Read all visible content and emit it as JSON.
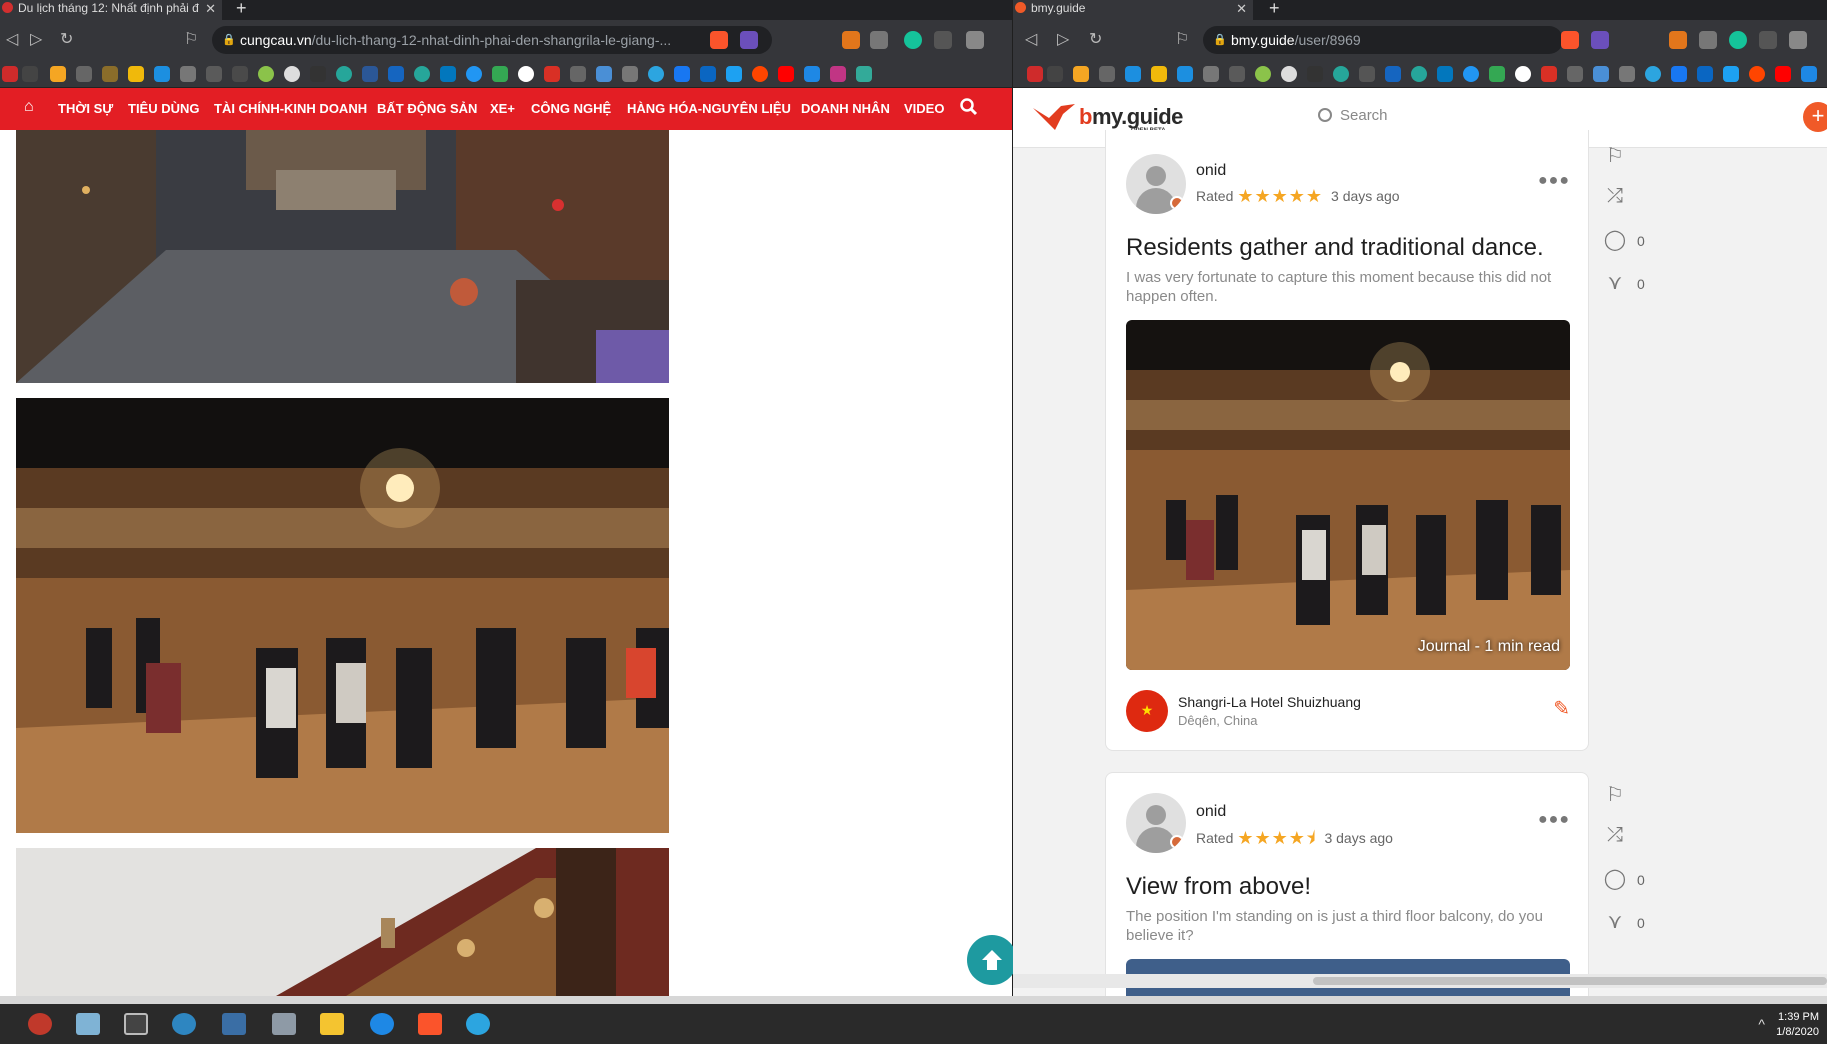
{
  "left_browser": {
    "tab_title": "Du lịch tháng 12: Nhất định phải đ",
    "url_host": "cungcau.vn",
    "url_path": "/du-lich-thang-12-nhat-dinh-phai-den-shangrila-le-giang-...",
    "shield_badge": "12",
    "nav_items": [
      "THỜI SỰ",
      "TIÊU DÙNG",
      "TÀI CHÍNH-KINH DOANH",
      "BẤT ĐỘNG SẢN",
      "XE+",
      "CÔNG NGHỆ",
      "HÀNG HÓA-NGUYÊN LIỆU",
      "DOANH NHÂN",
      "VIDEO"
    ],
    "brand_color": "#e31e24"
  },
  "right_browser": {
    "tab_title": "bmy.guide",
    "url_host": "bmy.guide",
    "url_path": "/user/8969",
    "logo": "bmy.guide",
    "logo_prefix": "b",
    "logo_rest": "my.guide",
    "logo_sub": "OPEN BETA",
    "search_placeholder": "Search",
    "accent_color": "#f05a28"
  },
  "posts": [
    {
      "username": "onid",
      "rated_label": "Rated",
      "rating": 5,
      "stars_text": "★★★★★",
      "time": "3 days ago",
      "title": "Residents gather and traditional dance.",
      "description": "I was very fortunate to capture this moment because this did not happen often.",
      "journal_label": "Journal - 1 min read",
      "place_name": "Shangri-La Hotel Shuizhuang",
      "place_location": "Dêqên, China",
      "comments": "0",
      "likes": "0"
    },
    {
      "username": "onid",
      "rated_label": "Rated",
      "rating": 4.5,
      "stars_text": "★★★★⯨",
      "time": "3 days ago",
      "title": "View from above!",
      "description": "The position I'm standing on is just a third floor balcony, do you believe it?",
      "comments": "0",
      "likes": "0"
    }
  ],
  "taskbar": {
    "time": "1:39 PM",
    "date": "1/8/2020"
  }
}
